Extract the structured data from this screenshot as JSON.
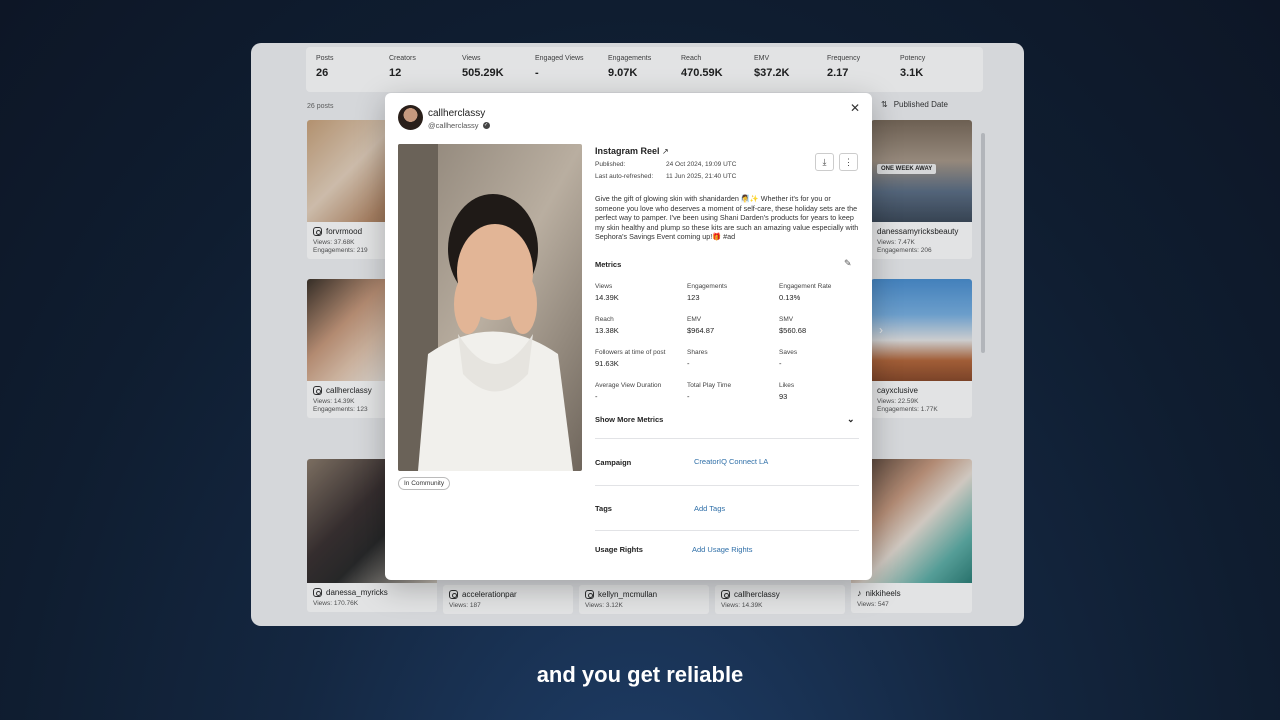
{
  "stats": [
    {
      "label": "Posts",
      "value": "26"
    },
    {
      "label": "Creators",
      "value": "12"
    },
    {
      "label": "Views",
      "value": "505.29K"
    },
    {
      "label": "Engaged Views",
      "value": "-"
    },
    {
      "label": "Engagements",
      "value": "9.07K"
    },
    {
      "label": "Reach",
      "value": "470.59K"
    },
    {
      "label": "EMV",
      "value": "$37.2K"
    },
    {
      "label": "Frequency",
      "value": "2.17"
    },
    {
      "label": "Potency",
      "value": "3.1K"
    }
  ],
  "grid": {
    "posts_count": "26 posts",
    "sort_label": "Published Date",
    "cards": [
      {
        "handle": "forvrmood",
        "views": "Views: 37.68K",
        "engagements": "Engagements: 219",
        "platform": "instagram"
      },
      {
        "handle": "danessamyricksbeauty",
        "views": "Views: 7.47K",
        "engagements": "Engagements: 206",
        "platform": "instagram"
      },
      {
        "handle": "callherclassy",
        "views": "Views: 14.39K",
        "engagements": "Engagements: 123",
        "platform": "instagram"
      },
      {
        "handle": "cayxclusive",
        "views": "Views: 22.59K",
        "engagements": "Engagements: 1.77K",
        "platform": "instagram"
      },
      {
        "handle": "danessa_myricks",
        "views": "Views: 170.76K",
        "platform": "instagram"
      },
      {
        "handle": "accelerationpar",
        "views": "Views: 187",
        "platform": "instagram"
      },
      {
        "handle": "kellyn_mcmullan",
        "views": "Views: 3.12K",
        "platform": "instagram"
      },
      {
        "handle": "callherclassy",
        "views": "Views: 14.39K",
        "platform": "instagram"
      },
      {
        "handle": "nikkiheels",
        "views": "Views: 547",
        "platform": "tiktok"
      }
    ],
    "one_week_tag": "ONE WEEK AWAY"
  },
  "modal": {
    "name": "callherclassy",
    "handle": "@callherclassy",
    "post_type": "Instagram Reel",
    "published_label": "Published:",
    "published_value": "24 Oct 2024, 19:09 UTC",
    "refreshed_label": "Last auto-refreshed:",
    "refreshed_value": "11 Jun 2025, 21:40 UTC",
    "caption": "Give the gift of glowing skin with shanidarden 🧖‍♀️✨ Whether it's for you or someone you love who deserves a moment of self-care, these holiday sets are the perfect way to pamper. I've been using Shani Darden's products for years to keep my skin healthy and plump so these kits are such an amazing value especially with Sephora's Savings Event coming up!🎁 #ad",
    "community_badge": "In Community",
    "metrics_title": "Metrics",
    "metrics": [
      {
        "label": "Views",
        "value": "14.39K"
      },
      {
        "label": "Engagements",
        "value": "123"
      },
      {
        "label": "Engagement Rate",
        "value": "0.13%"
      },
      {
        "label": "Reach",
        "value": "13.38K"
      },
      {
        "label": "EMV",
        "value": "$964.87"
      },
      {
        "label": "SMV",
        "value": "$560.68"
      },
      {
        "label": "Followers at time of post",
        "value": "91.63K"
      },
      {
        "label": "Shares",
        "value": "-"
      },
      {
        "label": "Saves",
        "value": "-"
      },
      {
        "label": "Average View Duration",
        "value": "-"
      },
      {
        "label": "Total Play Time",
        "value": "-"
      },
      {
        "label": "Likes",
        "value": "93"
      }
    ],
    "show_more": "Show More Metrics",
    "campaign_label": "Campaign",
    "campaign_value": "CreatorIQ Connect LA",
    "tags_label": "Tags",
    "tags_action": "Add Tags",
    "usage_label": "Usage Rights",
    "usage_action": "Add Usage Rights"
  },
  "subtitle": "and you get reliable"
}
